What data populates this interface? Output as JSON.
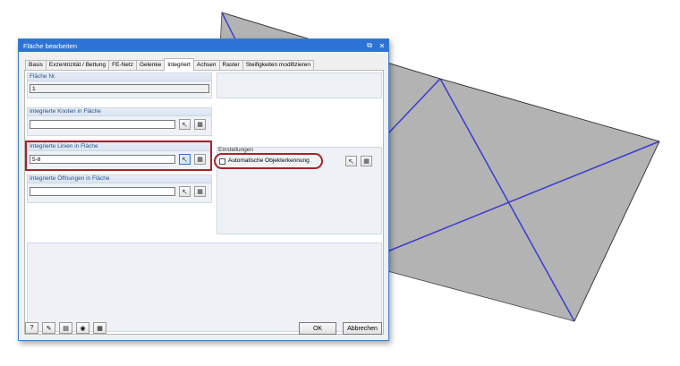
{
  "dialog": {
    "title": "Fläche bearbeiten",
    "tabs": [
      "Basis",
      "Exzentrizität / Bettung",
      "FE-Netz",
      "Gelenke",
      "Integriert",
      "Achsen",
      "Raster",
      "Steifigkeiten modifizieren"
    ],
    "active_tab": "Integriert",
    "surface_no": {
      "label": "Fläche Nr.",
      "value": "1"
    },
    "nodes": {
      "label": "Integrierte Knoten in Fläche",
      "value": ""
    },
    "lines": {
      "label": "Integrierte Linien in Fläche",
      "value": "5-8"
    },
    "openings": {
      "label": "Integrierte Öffnungen in Fläche",
      "value": ""
    },
    "settings": {
      "label": "Einstellungen",
      "auto_label": "Automatische Objekterkennung",
      "auto_checked": false
    },
    "buttons": {
      "ok": "OK",
      "cancel": "Abbrechen"
    }
  },
  "colors": {
    "titlebar": "#2d73d6",
    "highlight": "#a8232b",
    "surface": "#b3b3b3",
    "edge": "#3b3bd0"
  }
}
